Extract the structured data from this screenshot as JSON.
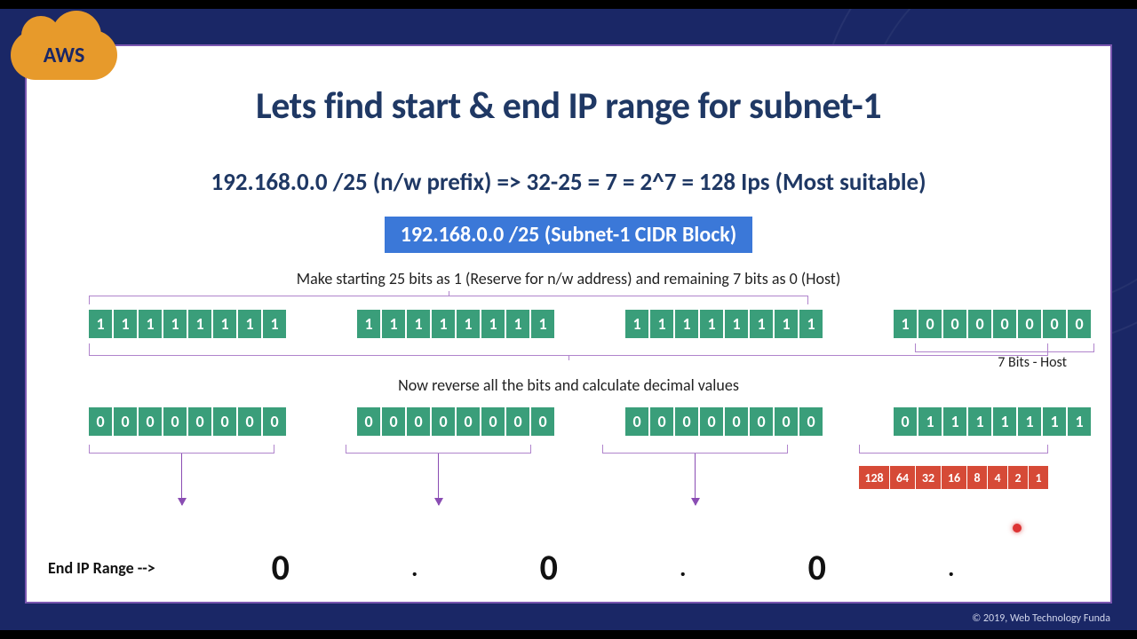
{
  "badge": {
    "label": "AWS"
  },
  "title": "Lets find start & end IP range for subnet-1",
  "subtitle": "192.168.0.0 /25 (n/w prefix) => 32-25 = 7 = 2^7 = 128 Ips (Most suitable)",
  "cidr_box": "192.168.0.0 /25 (Subnet-1 CIDR Block)",
  "instruction1": "Make starting 25 bits as 1 (Reserve for n/w address) and remaining 7 bits as 0 (Host)",
  "instruction2": "Now reverse all the bits and calculate decimal values",
  "host_label": "7 Bits - Host",
  "row1": {
    "octets": [
      [
        "1",
        "1",
        "1",
        "1",
        "1",
        "1",
        "1",
        "1"
      ],
      [
        "1",
        "1",
        "1",
        "1",
        "1",
        "1",
        "1",
        "1"
      ],
      [
        "1",
        "1",
        "1",
        "1",
        "1",
        "1",
        "1",
        "1"
      ],
      [
        "1",
        "0",
        "0",
        "0",
        "0",
        "0",
        "0",
        "0"
      ]
    ]
  },
  "row2": {
    "octets": [
      [
        "0",
        "0",
        "0",
        "0",
        "0",
        "0",
        "0",
        "0"
      ],
      [
        "0",
        "0",
        "0",
        "0",
        "0",
        "0",
        "0",
        "0"
      ],
      [
        "0",
        "0",
        "0",
        "0",
        "0",
        "0",
        "0",
        "0"
      ],
      [
        "0",
        "1",
        "1",
        "1",
        "1",
        "1",
        "1",
        "1"
      ]
    ]
  },
  "weights": [
    "128",
    "64",
    "32",
    "16",
    "8",
    "4",
    "2",
    "1"
  ],
  "end_ip": {
    "label": "End IP Range -->",
    "o1": "0",
    "o2": "0",
    "o3": "0",
    "dot": "."
  },
  "footer": "© 2019, Web Technology Funda"
}
